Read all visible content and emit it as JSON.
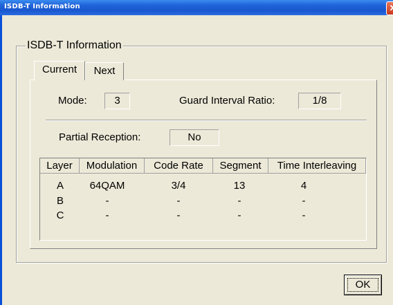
{
  "window": {
    "title": "ISDB-T Information",
    "close_glyph": "✕"
  },
  "group": {
    "label": "ISDB-T Information"
  },
  "tabs": [
    {
      "label": "Current"
    },
    {
      "label": "Next"
    }
  ],
  "fields": {
    "mode": {
      "label": "Mode:",
      "value": "3"
    },
    "guard_interval_ratio": {
      "label": "Guard Interval Ratio:",
      "value": "1/8"
    },
    "partial_reception": {
      "label": "Partial Reception:",
      "value": "No"
    }
  },
  "table": {
    "columns": [
      "Layer",
      "Modulation",
      "Code Rate",
      "Segment",
      "Time Interleaving"
    ],
    "rows": [
      [
        "A",
        "64QAM",
        "3/4",
        "13",
        "4"
      ],
      [
        "B",
        "-",
        "-",
        "-",
        "-"
      ],
      [
        "C",
        "-",
        "-",
        "-",
        "-"
      ]
    ]
  },
  "buttons": {
    "ok": "OK"
  },
  "colors": {
    "titlebar": "#1f63d8",
    "dialog_bg": "#ece9d8",
    "close_button": "#c8361a"
  }
}
